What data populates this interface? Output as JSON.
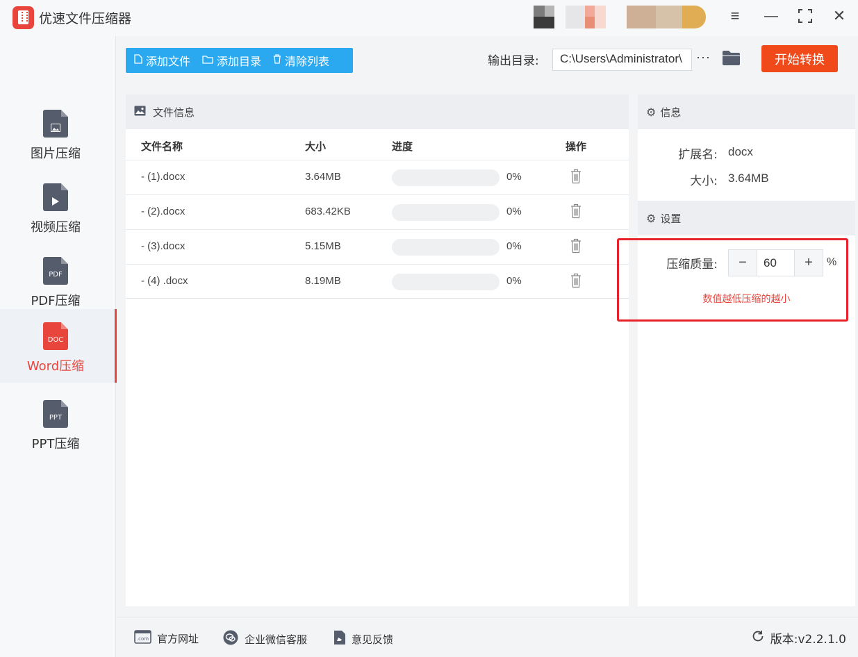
{
  "app": {
    "title": "优速文件压缩器"
  },
  "sidebar": {
    "items": [
      {
        "label": "图片压缩",
        "glyph": "",
        "active": false
      },
      {
        "label": "视频压缩",
        "glyph": "",
        "active": false
      },
      {
        "label": "PDF压缩",
        "glyph": "PDF",
        "active": false
      },
      {
        "label": "Word压缩",
        "glyph": "DOC",
        "active": true
      },
      {
        "label": "PPT压缩",
        "glyph": "PPT",
        "active": false
      }
    ]
  },
  "toolbar": {
    "add_file": "添加文件",
    "add_dir": "添加目录",
    "clear_list": "清除列表",
    "output_label": "输出目录:",
    "output_path": "C:\\Users\\Administrator\\",
    "more": "···",
    "start": "开始转换"
  },
  "file_panel": {
    "title": "文件信息",
    "columns": {
      "name": "文件名称",
      "size": "大小",
      "progress": "进度",
      "action": "操作"
    },
    "rows": [
      {
        "name": "- (1).docx",
        "size": "3.64MB",
        "progress_pct": "0%",
        "progress": 0
      },
      {
        "name": "- (2).docx",
        "size": "683.42KB",
        "progress_pct": "0%",
        "progress": 0
      },
      {
        "name": "- (3).docx",
        "size": "5.15MB",
        "progress_pct": "0%",
        "progress": 0
      },
      {
        "name": "- (4) .docx",
        "size": "8.19MB",
        "progress_pct": "0%",
        "progress": 0
      }
    ]
  },
  "info_panel": {
    "info_title": "信息",
    "ext_label": "扩展名:",
    "ext_value": "docx",
    "size_label": "大小:",
    "size_value": "3.64MB",
    "settings_title": "设置",
    "quality_label": "压缩质量:",
    "quality_value": "60",
    "minus": "−",
    "plus": "+",
    "unit": "%",
    "hint": "数值越低压缩的越小"
  },
  "footer": {
    "website": "官方网址",
    "wechat": "企业微信客服",
    "feedback": "意见反馈",
    "version": "版本:v2.2.1.0"
  },
  "colors": {
    "accent": "#2aa9f0",
    "start": "#f04a1b",
    "active": "#e8453c",
    "highlight_box": "#e8222a"
  }
}
